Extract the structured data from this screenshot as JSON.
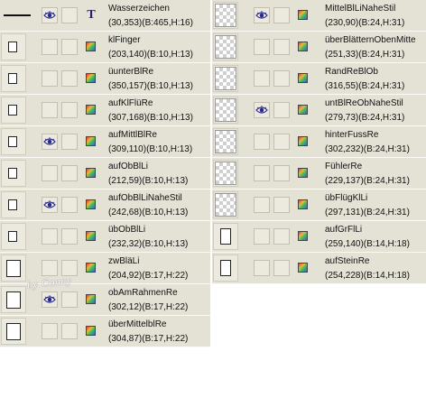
{
  "left_layers": [
    {
      "name": "Wasserzeichen",
      "info": "(30,353)(B:465,H:16)",
      "visible": true,
      "thumb": "line",
      "icon": "type"
    },
    {
      "name": "klFinger",
      "info": "(203,140)(B:10,H:13)",
      "visible": false,
      "thumb": "small",
      "icon": "layer"
    },
    {
      "name": "üunterBlRe",
      "info": "(350,157)(B:10,H:13)",
      "visible": false,
      "thumb": "small",
      "icon": "layer"
    },
    {
      "name": "aufKlFlüRe",
      "info": "(307,168)(B:10,H:13)",
      "visible": false,
      "thumb": "small",
      "icon": "layer"
    },
    {
      "name": "aufMittlBlRe",
      "info": "(309,110)(B:10,H:13)",
      "visible": true,
      "thumb": "small",
      "icon": "layer"
    },
    {
      "name": "aufObBlLi",
      "info": "(212,59)(B:10,H:13)",
      "visible": false,
      "thumb": "small",
      "icon": "layer"
    },
    {
      "name": "aufObBlLiNaheStil",
      "info": "(242,68)(B:10,H:13)",
      "visible": true,
      "thumb": "small",
      "icon": "layer"
    },
    {
      "name": "übObBlLi",
      "info": "(232,32)(B:10,H:13)",
      "visible": false,
      "thumb": "small",
      "icon": "layer"
    },
    {
      "name": "zwBläLi",
      "info": "(204,92)(B:17,H:22)",
      "visible": false,
      "thumb": "medium",
      "icon": "layer"
    },
    {
      "name": "obAmRahmenRe",
      "info": "(302,12)(B:17,H:22)",
      "visible": true,
      "thumb": "medium",
      "icon": "layer"
    },
    {
      "name": "überMittelblRe",
      "info": "(304,87)(B:17,H:22)",
      "visible": false,
      "thumb": "medium",
      "icon": "layer"
    }
  ],
  "right_layers": [
    {
      "name": "MittelBlLiNaheStil",
      "info": "(230,90)(B:24,H:31)",
      "visible": true,
      "thumb": "checker",
      "icon": "layer"
    },
    {
      "name": "überBlätternObenMitte",
      "info": "(251,33)(B:24,H:31)",
      "visible": false,
      "thumb": "checker",
      "icon": "layer"
    },
    {
      "name": "RandReBlOb",
      "info": "(316,55)(B:24,H:31)",
      "visible": false,
      "thumb": "checker",
      "icon": "layer"
    },
    {
      "name": "untBlReObNaheStil",
      "info": "(279,73)(B:24,H:31)",
      "visible": true,
      "thumb": "checker",
      "icon": "layer"
    },
    {
      "name": "hinterFussRe",
      "info": "(302,232)(B:24,H:31)",
      "visible": false,
      "thumb": "checker",
      "icon": "layer"
    },
    {
      "name": "FühlerRe",
      "info": "(229,137)(B:24,H:31)",
      "visible": false,
      "thumb": "checker",
      "icon": "layer"
    },
    {
      "name": "übFlügKlLi",
      "info": "(297,131)(B:24,H:31)",
      "visible": false,
      "thumb": "checker",
      "icon": "layer"
    },
    {
      "name": "aufGrFlLi",
      "info": "(259,140)(B:14,H:18)",
      "visible": false,
      "thumb": "tall",
      "icon": "layer"
    },
    {
      "name": "aufSteinRe",
      "info": "(254,228)(B:14,H:18)",
      "visible": false,
      "thumb": "tall",
      "icon": "layer"
    }
  ],
  "watermark_text": "by Conny",
  "icons": {
    "visible": "eye-icon",
    "type_layer": "type-t-icon",
    "raster_layer": "layer-icon"
  },
  "colors": {
    "panel": "#e4e1d5",
    "eye": "#2a2a8a",
    "type_icon": "#202080"
  }
}
